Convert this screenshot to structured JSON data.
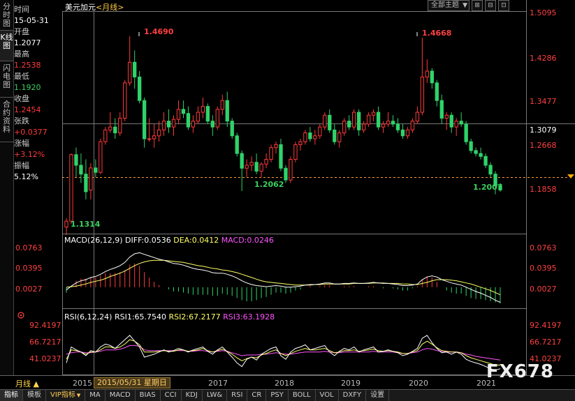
{
  "left_tabs": [
    "分时图",
    "K线图",
    "闪电图",
    "合约资料"
  ],
  "active_tab_index": 1,
  "info": {
    "time_label": "时间",
    "time_value": "15-05-31",
    "open_label": "开盘",
    "open_value": "1.2077",
    "high_label": "最高",
    "high_value": "1.2538",
    "low_label": "最低",
    "low_value": "1.1920",
    "close_label": "收盘",
    "close_value": "1.2454",
    "change_label": "张跌",
    "change_value": "+0.0377",
    "pct_label": "涨幅",
    "pct_value": "+3.12%",
    "amp_label": "振幅",
    "amp_value": "5.12%"
  },
  "header": {
    "symbol": "美元加元",
    "period": "<月线>"
  },
  "toolbar": {
    "theme_select": "全部主题",
    "btn1": "⊞",
    "btn2": "⊟",
    "btn3": "⊡"
  },
  "price_axis": [
    "1.5095",
    "1.4286",
    "1.3477",
    "1.2668",
    "1.1858"
  ],
  "current_price": "1.3079",
  "annotations": [
    {
      "text": "1.4690",
      "color": "#ff4040"
    },
    {
      "text": "1.4668",
      "color": "#ff4040"
    },
    {
      "text": "1.2062",
      "color": "#3ad15f"
    },
    {
      "text": "1.2007",
      "color": "#3ad15f"
    },
    {
      "text": "1.1314",
      "color": "#3ad15f"
    }
  ],
  "macd": {
    "title": "MACD(26,12,9)",
    "diff": "DIFF:0.0536",
    "dea": "DEA:0.0412",
    "macd": "MACD:0.0246",
    "axis": [
      "0.0763",
      "0.0395",
      "0.0027"
    ],
    "diff_color": "#ffffff",
    "dea_color": "#ffff66",
    "macd_color": "#ff55ff"
  },
  "rsi": {
    "title": "RSI(6,12,24)",
    "rsi1": "RSI1:65.7540",
    "rsi2": "RSI2:67.2177",
    "rsi3": "RSI3:63.1928",
    "axis": [
      "92.4197",
      "66.7217",
      "41.0237"
    ],
    "rsi1_color": "#ffffff",
    "rsi2_color": "#ffff66",
    "rsi3_color": "#ff55ff"
  },
  "time_axis": {
    "period_button": "月线 ▲",
    "cursor_date": "2015/05/31 星期日",
    "years": [
      "2015",
      "2017",
      "2018",
      "2019",
      "2020",
      "2021"
    ]
  },
  "bottom_tabs": [
    "指标",
    "模板",
    "VIP指标",
    "MA",
    "MACD",
    "BIAS",
    "CCI",
    "KDJ",
    "LW&",
    "RSI",
    "CR",
    "PSY",
    "BOLL",
    "VOL",
    "DXFY",
    "设置"
  ],
  "watermark": "FX678",
  "colors": {
    "up": "#ff3a3a",
    "down": "#2ed36a",
    "bg": "#000000"
  },
  "chart_data": {
    "type": "candlestick",
    "price_range": [
      1.135,
      1.5095
    ],
    "candles": [
      [
        1.145,
        1.16,
        1.1314,
        1.155
      ],
      [
        1.155,
        1.27,
        1.15,
        1.268
      ],
      [
        1.268,
        1.28,
        1.23,
        1.25
      ],
      [
        1.25,
        1.27,
        1.22,
        1.235
      ],
      [
        1.235,
        1.26,
        1.192,
        1.205
      ],
      [
        1.2077,
        1.2538,
        1.192,
        1.2454
      ],
      [
        1.2454,
        1.26,
        1.23,
        1.238
      ],
      [
        1.238,
        1.295,
        1.235,
        1.29
      ],
      [
        1.29,
        1.315,
        1.285,
        1.31
      ],
      [
        1.31,
        1.34,
        1.305,
        1.315
      ],
      [
        1.315,
        1.33,
        1.295,
        1.305
      ],
      [
        1.305,
        1.34,
        1.3,
        1.33
      ],
      [
        1.33,
        1.395,
        1.325,
        1.39
      ],
      [
        1.39,
        1.469,
        1.385,
        1.425
      ],
      [
        1.425,
        1.445,
        1.38,
        1.4
      ],
      [
        1.4,
        1.41,
        1.355,
        1.36
      ],
      [
        1.36,
        1.365,
        1.28,
        1.295
      ],
      [
        1.295,
        1.33,
        1.29,
        1.295
      ],
      [
        1.295,
        1.32,
        1.28,
        1.3
      ],
      [
        1.3,
        1.325,
        1.29,
        1.31
      ],
      [
        1.31,
        1.34,
        1.3,
        1.325
      ],
      [
        1.325,
        1.345,
        1.305,
        1.315
      ],
      [
        1.315,
        1.335,
        1.3,
        1.328
      ],
      [
        1.328,
        1.36,
        1.32,
        1.345
      ],
      [
        1.345,
        1.36,
        1.33,
        1.338
      ],
      [
        1.338,
        1.35,
        1.31,
        1.315
      ],
      [
        1.315,
        1.335,
        1.305,
        1.325
      ],
      [
        1.325,
        1.35,
        1.32,
        1.34
      ],
      [
        1.34,
        1.365,
        1.33,
        1.35
      ],
      [
        1.35,
        1.355,
        1.32,
        1.325
      ],
      [
        1.325,
        1.335,
        1.3,
        1.315
      ],
      [
        1.315,
        1.35,
        1.31,
        1.345
      ],
      [
        1.345,
        1.37,
        1.335,
        1.36
      ],
      [
        1.36,
        1.375,
        1.315,
        1.325
      ],
      [
        1.325,
        1.33,
        1.295,
        1.3
      ],
      [
        1.3,
        1.305,
        1.265,
        1.27
      ],
      [
        1.27,
        1.275,
        1.2062,
        1.245
      ],
      [
        1.245,
        1.26,
        1.23,
        1.25
      ],
      [
        1.25,
        1.265,
        1.24,
        1.255
      ],
      [
        1.255,
        1.27,
        1.235,
        1.24
      ],
      [
        1.24,
        1.255,
        1.23,
        1.252
      ],
      [
        1.252,
        1.27,
        1.245,
        1.26
      ],
      [
        1.26,
        1.285,
        1.255,
        1.28
      ],
      [
        1.28,
        1.29,
        1.27,
        1.285
      ],
      [
        1.285,
        1.295,
        1.24,
        1.245
      ],
      [
        1.245,
        1.25,
        1.22,
        1.225
      ],
      [
        1.225,
        1.265,
        1.22,
        1.26
      ],
      [
        1.26,
        1.29,
        1.255,
        1.285
      ],
      [
        1.285,
        1.295,
        1.275,
        1.29
      ],
      [
        1.29,
        1.31,
        1.285,
        1.305
      ],
      [
        1.305,
        1.315,
        1.29,
        1.295
      ],
      [
        1.295,
        1.31,
        1.285,
        1.3
      ],
      [
        1.3,
        1.32,
        1.295,
        1.315
      ],
      [
        1.315,
        1.34,
        1.31,
        1.335
      ],
      [
        1.335,
        1.345,
        1.305,
        1.31
      ],
      [
        1.31,
        1.32,
        1.285,
        1.29
      ],
      [
        1.29,
        1.31,
        1.28,
        1.305
      ],
      [
        1.305,
        1.33,
        1.3,
        1.325
      ],
      [
        1.325,
        1.335,
        1.31,
        1.315
      ],
      [
        1.315,
        1.345,
        1.31,
        1.34
      ],
      [
        1.34,
        1.345,
        1.3,
        1.31
      ],
      [
        1.31,
        1.325,
        1.305,
        1.32
      ],
      [
        1.32,
        1.34,
        1.315,
        1.335
      ],
      [
        1.335,
        1.345,
        1.325,
        1.34
      ],
      [
        1.34,
        1.35,
        1.31,
        1.315
      ],
      [
        1.315,
        1.325,
        1.305,
        1.32
      ],
      [
        1.32,
        1.34,
        1.315,
        1.325
      ],
      [
        1.325,
        1.335,
        1.315,
        1.32
      ],
      [
        1.32,
        1.33,
        1.305,
        1.31
      ],
      [
        1.31,
        1.32,
        1.295,
        1.3
      ],
      [
        1.3,
        1.315,
        1.295,
        1.31
      ],
      [
        1.31,
        1.33,
        1.305,
        1.325
      ],
      [
        1.325,
        1.35,
        1.32,
        1.34
      ],
      [
        1.34,
        1.4668,
        1.335,
        1.4
      ],
      [
        1.4,
        1.43,
        1.39,
        1.41
      ],
      [
        1.41,
        1.415,
        1.38,
        1.39
      ],
      [
        1.39,
        1.395,
        1.35,
        1.36
      ],
      [
        1.36,
        1.37,
        1.32,
        1.33
      ],
      [
        1.33,
        1.34,
        1.31,
        1.335
      ],
      [
        1.335,
        1.34,
        1.305,
        1.315
      ],
      [
        1.315,
        1.33,
        1.3,
        1.325
      ],
      [
        1.325,
        1.34,
        1.315,
        1.32
      ],
      [
        1.32,
        1.325,
        1.285,
        1.29
      ],
      [
        1.29,
        1.295,
        1.27,
        1.275
      ],
      [
        1.275,
        1.28,
        1.265,
        1.27
      ],
      [
        1.27,
        1.28,
        1.26,
        1.265
      ],
      [
        1.265,
        1.27,
        1.245,
        1.25
      ],
      [
        1.25,
        1.255,
        1.23,
        1.235
      ],
      [
        1.235,
        1.24,
        1.2007,
        1.215
      ],
      [
        1.215,
        1.22,
        1.205,
        1.208
      ]
    ],
    "macd_range": [
      -0.039,
      0.08
    ],
    "macd_diff": [
      -0.005,
      0.002,
      0.008,
      0.012,
      0.014,
      0.018,
      0.02,
      0.024,
      0.029,
      0.033,
      0.036,
      0.04,
      0.046,
      0.056,
      0.062,
      0.064,
      0.061,
      0.058,
      0.055,
      0.052,
      0.05,
      0.047,
      0.044,
      0.043,
      0.041,
      0.038,
      0.035,
      0.033,
      0.032,
      0.03,
      0.027,
      0.026,
      0.026,
      0.024,
      0.021,
      0.017,
      0.012,
      0.008,
      0.005,
      0.003,
      0.002,
      0.001,
      0.002,
      0.003,
      0.002,
      0.0,
      0.0,
      0.001,
      0.002,
      0.004,
      0.005,
      0.005,
      0.006,
      0.008,
      0.008,
      0.006,
      0.006,
      0.007,
      0.007,
      0.008,
      0.007,
      0.007,
      0.008,
      0.009,
      0.008,
      0.007,
      0.007,
      0.006,
      0.005,
      0.003,
      0.003,
      0.004,
      0.006,
      0.014,
      0.019,
      0.021,
      0.019,
      0.014,
      0.011,
      0.008,
      0.006,
      0.004,
      0.0,
      -0.004,
      -0.008,
      -0.011,
      -0.015,
      -0.019,
      -0.024,
      -0.028
    ],
    "macd_dea": [
      0.0,
      0.001,
      0.002,
      0.004,
      0.006,
      0.009,
      0.011,
      0.013,
      0.016,
      0.02,
      0.023,
      0.026,
      0.03,
      0.035,
      0.04,
      0.044,
      0.047,
      0.049,
      0.05,
      0.05,
      0.05,
      0.049,
      0.048,
      0.047,
      0.046,
      0.044,
      0.042,
      0.04,
      0.039,
      0.037,
      0.035,
      0.034,
      0.032,
      0.031,
      0.029,
      0.027,
      0.024,
      0.021,
      0.018,
      0.015,
      0.012,
      0.01,
      0.009,
      0.008,
      0.007,
      0.006,
      0.005,
      0.004,
      0.004,
      0.004,
      0.004,
      0.005,
      0.005,
      0.006,
      0.006,
      0.006,
      0.006,
      0.006,
      0.006,
      0.007,
      0.007,
      0.007,
      0.007,
      0.008,
      0.008,
      0.008,
      0.007,
      0.007,
      0.007,
      0.006,
      0.006,
      0.005,
      0.005,
      0.007,
      0.009,
      0.012,
      0.014,
      0.014,
      0.014,
      0.013,
      0.012,
      0.01,
      0.008,
      0.006,
      0.003,
      0.0,
      -0.003,
      -0.006,
      -0.01,
      -0.014
    ],
    "macd_hist": [
      -0.01,
      0.002,
      0.012,
      0.016,
      0.016,
      0.018,
      0.018,
      0.022,
      0.026,
      0.026,
      0.026,
      0.028,
      0.032,
      0.042,
      0.044,
      0.04,
      0.028,
      0.018,
      0.01,
      0.004,
      0.0,
      -0.004,
      -0.008,
      -0.008,
      -0.01,
      -0.012,
      -0.014,
      -0.014,
      -0.014,
      -0.014,
      -0.016,
      -0.016,
      -0.012,
      -0.014,
      -0.016,
      -0.02,
      -0.024,
      -0.026,
      -0.026,
      -0.024,
      -0.02,
      -0.018,
      -0.014,
      -0.01,
      -0.01,
      -0.012,
      -0.01,
      -0.006,
      -0.004,
      0.0,
      0.002,
      0.0,
      0.002,
      0.004,
      0.004,
      0.0,
      0.0,
      0.002,
      0.002,
      0.002,
      0.0,
      0.0,
      0.002,
      0.002,
      0.0,
      -0.002,
      0.0,
      -0.002,
      -0.004,
      -0.006,
      -0.006,
      -0.002,
      0.002,
      0.014,
      0.02,
      0.018,
      0.01,
      0.0,
      -0.006,
      -0.01,
      -0.012,
      -0.012,
      -0.016,
      -0.02,
      -0.022,
      -0.022,
      -0.024,
      -0.026,
      -0.028,
      -0.03
    ],
    "rsi_range": [
      25,
      100
    ],
    "rsi1": [
      40,
      62,
      58,
      55,
      50,
      57,
      55,
      62,
      66,
      64,
      60,
      66,
      72,
      78,
      70,
      62,
      48,
      50,
      52,
      55,
      58,
      55,
      57,
      60,
      58,
      55,
      58,
      60,
      62,
      56,
      52,
      58,
      62,
      55,
      48,
      40,
      35,
      45,
      48,
      44,
      52,
      56,
      60,
      62,
      50,
      45,
      55,
      60,
      62,
      65,
      58,
      60,
      62,
      64,
      55,
      50,
      56,
      60,
      58,
      62,
      55,
      58,
      60,
      62,
      55,
      56,
      58,
      56,
      54,
      50,
      52,
      56,
      60,
      74,
      78,
      68,
      60,
      54,
      55,
      52,
      55,
      52,
      45,
      42,
      40,
      38,
      35,
      32,
      30,
      32
    ],
    "rsi2": [
      45,
      58,
      57,
      55,
      52,
      55,
      55,
      58,
      62,
      62,
      60,
      62,
      66,
      72,
      70,
      65,
      55,
      55,
      55,
      56,
      57,
      56,
      56,
      58,
      58,
      56,
      57,
      58,
      60,
      57,
      55,
      57,
      59,
      56,
      52,
      47,
      43,
      46,
      48,
      47,
      51,
      53,
      56,
      58,
      53,
      50,
      53,
      56,
      58,
      60,
      58,
      58,
      59,
      60,
      57,
      54,
      55,
      57,
      57,
      58,
      56,
      57,
      58,
      59,
      57,
      56,
      57,
      56,
      55,
      53,
      53,
      55,
      57,
      66,
      70,
      66,
      61,
      57,
      56,
      55,
      55,
      54,
      50,
      47,
      45,
      43,
      41,
      39,
      37,
      37
    ],
    "rsi3": [
      52,
      54,
      55,
      55,
      54,
      54,
      55,
      56,
      58,
      58,
      58,
      59,
      61,
      64,
      64,
      63,
      58,
      57,
      57,
      57,
      57,
      57,
      57,
      57,
      57,
      56,
      56,
      57,
      57,
      56,
      55,
      56,
      57,
      56,
      54,
      52,
      50,
      51,
      51,
      51,
      52,
      52,
      53,
      54,
      53,
      52,
      52,
      53,
      54,
      55,
      55,
      55,
      55,
      56,
      55,
      54,
      54,
      55,
      55,
      55,
      55,
      55,
      55,
      56,
      55,
      55,
      55,
      55,
      54,
      53,
      53,
      54,
      55,
      58,
      60,
      59,
      57,
      56,
      55,
      55,
      55,
      54,
      52,
      51,
      49,
      48,
      47,
      46,
      45,
      44
    ]
  }
}
